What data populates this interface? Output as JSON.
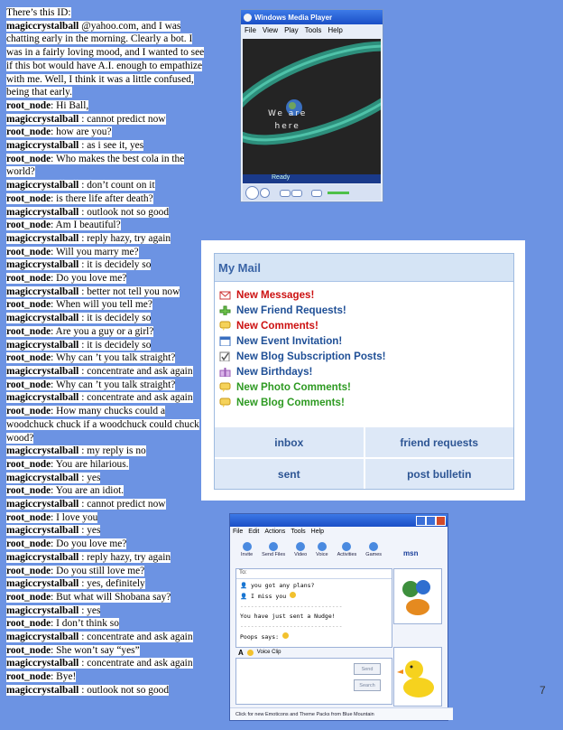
{
  "intro": "There’s this ID: magiccrystalball @yahoo.com, and I was chatting early in the morning. Clearly a bot. I was in a fairly loving mood, and I wanted to see if this bot would have A.I. enough to empathize with me. Well, I think it was a little confused, being that early.",
  "intro_parts": [
    "There’s this ID:",
    "magiccrystalball",
    " @yahoo.com, and I was chatting early in the morning. Clearly a bot. I was in a fairly loving mood, and I wanted to see if this bot would have A.I. enough to empathize with me. Well, I think it was a little confused, being that early."
  ],
  "chat": [
    {
      "who": "root_node",
      "text": ": Hi Ball,"
    },
    {
      "who": "magiccrystalball",
      "text": " : cannot predict now"
    },
    {
      "who": "root_node",
      "text": ": how are you?"
    },
    {
      "who": "magiccrystalball",
      "text": " : as i see it, yes"
    },
    {
      "who": "root_node",
      "text": ": Who makes the best cola in the world?"
    },
    {
      "who": "magiccrystalball",
      "text": " : don’t count on it"
    },
    {
      "who": "root_node",
      "text": ": is there life after death?"
    },
    {
      "who": "magiccrystalball",
      "text": " : outlook not so good"
    },
    {
      "who": "root_node",
      "text": ": Am I beautiful?"
    },
    {
      "who": "magiccrystalball",
      "text": " : reply hazy, try again"
    },
    {
      "who": "root_node",
      "text": ": Will you marry me?"
    },
    {
      "who": "magiccrystalball",
      "text": " : it is decidely so"
    },
    {
      "who": "root_node",
      "text": ": Do you love me?"
    },
    {
      "who": "magiccrystalball",
      "text": " : better not tell you now"
    },
    {
      "who": "root_node",
      "text": ": When will you tell me?"
    },
    {
      "who": "magiccrystalball",
      "text": " : it is decidely so"
    },
    {
      "who": "root_node",
      "text": ": Are you a guy or a girl?"
    },
    {
      "who": "magiccrystalball",
      "text": " : it is decidely so"
    },
    {
      "who": "root_node",
      "text": ": Why can ’t you talk straight?"
    },
    {
      "who": "magiccrystalball",
      "text": " : concentrate and ask again"
    },
    {
      "who": "root_node",
      "text": ": Why can ’t you talk straight?"
    },
    {
      "who": "magiccrystalball",
      "text": " : concentrate and ask again"
    },
    {
      "who": "root_node",
      "text": ": How many chucks could a woodchuck chuck if a woodchuck could chuck wood?"
    },
    {
      "who": "magiccrystalball",
      "text": " : my reply is no"
    },
    {
      "who": "root_node",
      "text": ": You are hilarious."
    },
    {
      "who": "magiccrystalball",
      "text": " : yes"
    },
    {
      "who": "root_node",
      "text": ": You are an idiot."
    },
    {
      "who": "magiccrystalball",
      "text": " : cannot predict now"
    },
    {
      "who": "root_node",
      "text": ": I love you"
    },
    {
      "who": "magiccrystalball",
      "text": " : yes"
    },
    {
      "who": "root_node",
      "text": ": Do you love me?"
    },
    {
      "who": "magiccrystalball",
      "text": " : reply hazy, try again"
    },
    {
      "who": "root_node",
      "text": ": Do you still love me?"
    },
    {
      "who": "magiccrystalball",
      "text": " : yes, definitely"
    },
    {
      "who": "root_node",
      "text": ": But what will Shobana say?"
    },
    {
      "who": "magiccrystalball",
      "text": " : yes"
    },
    {
      "who": "root_node",
      "text": ": I don’t think so"
    },
    {
      "who": "magiccrystalball",
      "text": " : concentrate and ask again"
    },
    {
      "who": "root_node",
      "text": ": She won’t say “yes”"
    },
    {
      "who": "magiccrystalball",
      "text": " : concentrate and ask again"
    },
    {
      "who": "root_node",
      "text": ": Bye!"
    },
    {
      "who": "magiccrystalball",
      "text": " : outlook not so good"
    }
  ],
  "page_number": "7",
  "wmp": {
    "title": "Windows Media Player",
    "menu": [
      "File",
      "View",
      "Play",
      "Tools",
      "Help"
    ],
    "video_line1": "We are",
    "video_line2": "here",
    "status": "Ready"
  },
  "mail": {
    "title": "My Mail",
    "items": [
      {
        "label": "New Messages!",
        "color": "#cc1111",
        "icon": "envelope-icon"
      },
      {
        "label": "New Friend Requests!",
        "color": "#1f4f96",
        "icon": "plus-icon"
      },
      {
        "label": "New Comments!",
        "color": "#cc1111",
        "icon": "speech-bubble-icon"
      },
      {
        "label": "New Event Invitation!",
        "color": "#1f4f96",
        "icon": "calendar-icon"
      },
      {
        "label": "New Blog Subscription Posts!",
        "color": "#1f4f96",
        "icon": "checkbox-icon"
      },
      {
        "label": "New Birthdays!",
        "color": "#1f4f96",
        "icon": "gift-icon"
      },
      {
        "label": "New Photo Comments!",
        "color": "#2e9a22",
        "icon": "speech-bubble-icon"
      },
      {
        "label": "New Blog Comments!",
        "color": "#2e9a22",
        "icon": "speech-bubble-icon"
      }
    ],
    "buttons": [
      "inbox",
      "friend requests",
      "sent",
      "post bulletin"
    ]
  },
  "msn": {
    "menu": [
      "File",
      "Edit",
      "Actions",
      "Tools",
      "Help"
    ],
    "tools": [
      "Invite",
      "Send Files",
      "Video",
      "Voice",
      "Activities",
      "Games"
    ],
    "brand": "msn",
    "to_label": "To:",
    "lines": [
      "you got any plans?",
      "I miss you",
      "You have just sent a Nudge!",
      "Poops says:"
    ],
    "voice_clip": "Voice Clip",
    "send": "Send",
    "search": "Search",
    "footer": "Click for new Emoticons and Theme Packs from Blue Mountain"
  }
}
